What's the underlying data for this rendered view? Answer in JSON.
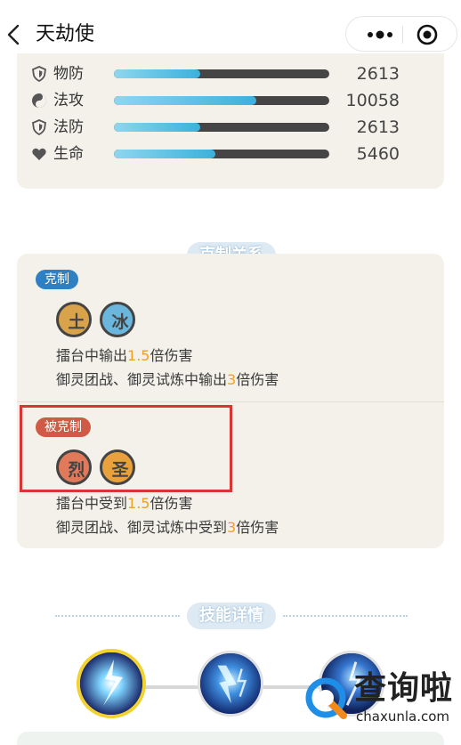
{
  "header": {
    "title": "天劫使",
    "back_icon": "chevron-left-icon",
    "more_icon": "more-dots-icon",
    "close_icon": "target-circle-icon"
  },
  "stats": [
    {
      "label": "物防",
      "value": "2613",
      "icon": "shield-icon",
      "fill_fraction": 0.4
    },
    {
      "label": "法攻",
      "value": "10058",
      "icon": "yin-yang-icon",
      "fill_fraction": 0.66
    },
    {
      "label": "法防",
      "value": "2613",
      "icon": "shield-icon",
      "fill_fraction": 0.4
    },
    {
      "label": "生命",
      "value": "5460",
      "icon": "heart-icon",
      "fill_fraction": 0.47
    }
  ],
  "counter_section": {
    "title": "克制关系",
    "counters": {
      "badge": "克制",
      "elements": [
        "土",
        "冰"
      ],
      "line1": {
        "pre": "擂台中输出",
        "num": "1.5",
        "post": "倍伤害"
      },
      "line2": {
        "pre": "御灵团战、御灵试炼中输出",
        "num": "3",
        "post": "倍伤害"
      }
    },
    "countered_by": {
      "badge": "被克制",
      "elements": [
        "烈",
        "圣"
      ],
      "line1": {
        "pre": "擂台中受到",
        "num": "1.5",
        "post": "倍伤害"
      },
      "line2": {
        "pre": "御灵团战、御灵试炼中受到",
        "num": "3",
        "post": "倍伤害"
      }
    }
  },
  "skills_section": {
    "title": "技能详情",
    "skills": [
      {
        "icon": "lightning-burst-icon",
        "selected": true
      },
      {
        "icon": "lightning-storm-icon",
        "selected": false
      },
      {
        "icon": "lightning-strike-icon",
        "selected": false
      }
    ]
  },
  "watermark": {
    "text": "查询啦",
    "url": "chaxunla.com"
  },
  "colors": {
    "card_bg": "#f3f1ea",
    "accent_blue": "#2f7fc3",
    "accent_red": "#cf5a45",
    "highlight_number": "#f0a020",
    "annotation_box": "#d93535"
  }
}
